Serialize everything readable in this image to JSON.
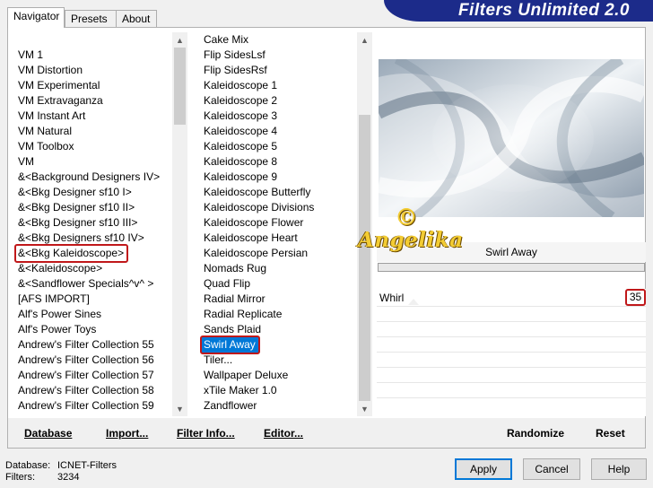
{
  "tabs": [
    "Navigator",
    "Presets",
    "About"
  ],
  "banner": {
    "title": "Filters Unlimited 2.0"
  },
  "categories": {
    "items": [
      "VM 1",
      "VM Distortion",
      "VM Experimental",
      "VM Extravaganza",
      "VM Instant Art",
      "VM Natural",
      "VM Toolbox",
      "VM",
      "&<Background Designers IV>",
      "&<Bkg Designer sf10 I>",
      "&<Bkg Designer sf10 II>",
      "&<Bkg Designer sf10 III>",
      "&<Bkg Designers sf10 IV>",
      "&<Bkg Kaleidoscope>",
      "&<Kaleidoscope>",
      "&<Sandflower Specials^v^ >",
      "[AFS IMPORT]",
      "Alf's Power Sines",
      "Alf's Power Toys",
      "Andrew's Filter Collection 55",
      "Andrew's Filter Collection 56",
      "Andrew's Filter Collection 57",
      "Andrew's Filter Collection 58",
      "Andrew's Filter Collection 59"
    ],
    "selected": "&<Bkg Kaleidoscope>"
  },
  "filters": {
    "items": [
      "Cake Mix",
      "Flip SidesLsf",
      "Flip SidesRsf",
      "Kaleidoscope 1",
      "Kaleidoscope 2",
      "Kaleidoscope 3",
      "Kaleidoscope 4",
      "Kaleidoscope 5",
      "Kaleidoscope 8",
      "Kaleidoscope 9",
      "Kaleidoscope Butterfly",
      "Kaleidoscope Divisions",
      "Kaleidoscope Flower",
      "Kaleidoscope Heart",
      "Kaleidoscope Persian",
      "Nomads Rug",
      "Quad Flip",
      "Radial Mirror",
      "Radial Replicate",
      "Sands Plaid",
      "Swirl Away",
      "Tiler...",
      "Wallpaper Deluxe",
      "xTile Maker 1.0",
      "Zandflower"
    ],
    "selected": "Swirl Away"
  },
  "filter_panel": {
    "name": "Swirl Away",
    "param_label": "Whirl",
    "param_value": "35"
  },
  "watermark": {
    "text": "Angelika",
    "symbol": "©"
  },
  "commands": {
    "database": "Database",
    "import": "Import...",
    "filter_info": "Filter Info...",
    "editor": "Editor...",
    "randomize": "Randomize",
    "reset": "Reset"
  },
  "status": {
    "database_label": "Database:",
    "database_value": "ICNET-Filters",
    "filters_label": "Filters:",
    "filters_value": "3234"
  },
  "dialog": {
    "apply": "Apply",
    "cancel": "Cancel",
    "help": "Help"
  },
  "colors": {
    "selection": "#0078d7",
    "highlight": "#c0181a",
    "banner": "#1c2b8a"
  }
}
